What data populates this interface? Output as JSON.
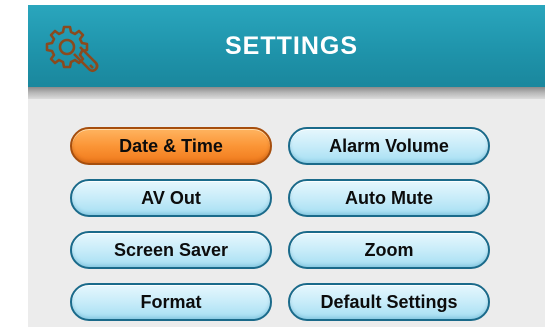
{
  "header": {
    "title": "SETTINGS",
    "icon": "gear-wrench-icon"
  },
  "menu": {
    "selected_index": 0,
    "left": [
      {
        "label": "Date & Time"
      },
      {
        "label": "AV Out"
      },
      {
        "label": "Screen Saver"
      },
      {
        "label": "Format"
      }
    ],
    "right": [
      {
        "label": "Alarm Volume"
      },
      {
        "label": "Auto Mute"
      },
      {
        "label": "Zoom"
      },
      {
        "label": "Default Settings"
      }
    ]
  },
  "colors": {
    "header": "#1f94ab",
    "button": "#c8ecf9",
    "button_border": "#1a6a8a",
    "selected": "#fb9536",
    "background": "#ececec"
  }
}
